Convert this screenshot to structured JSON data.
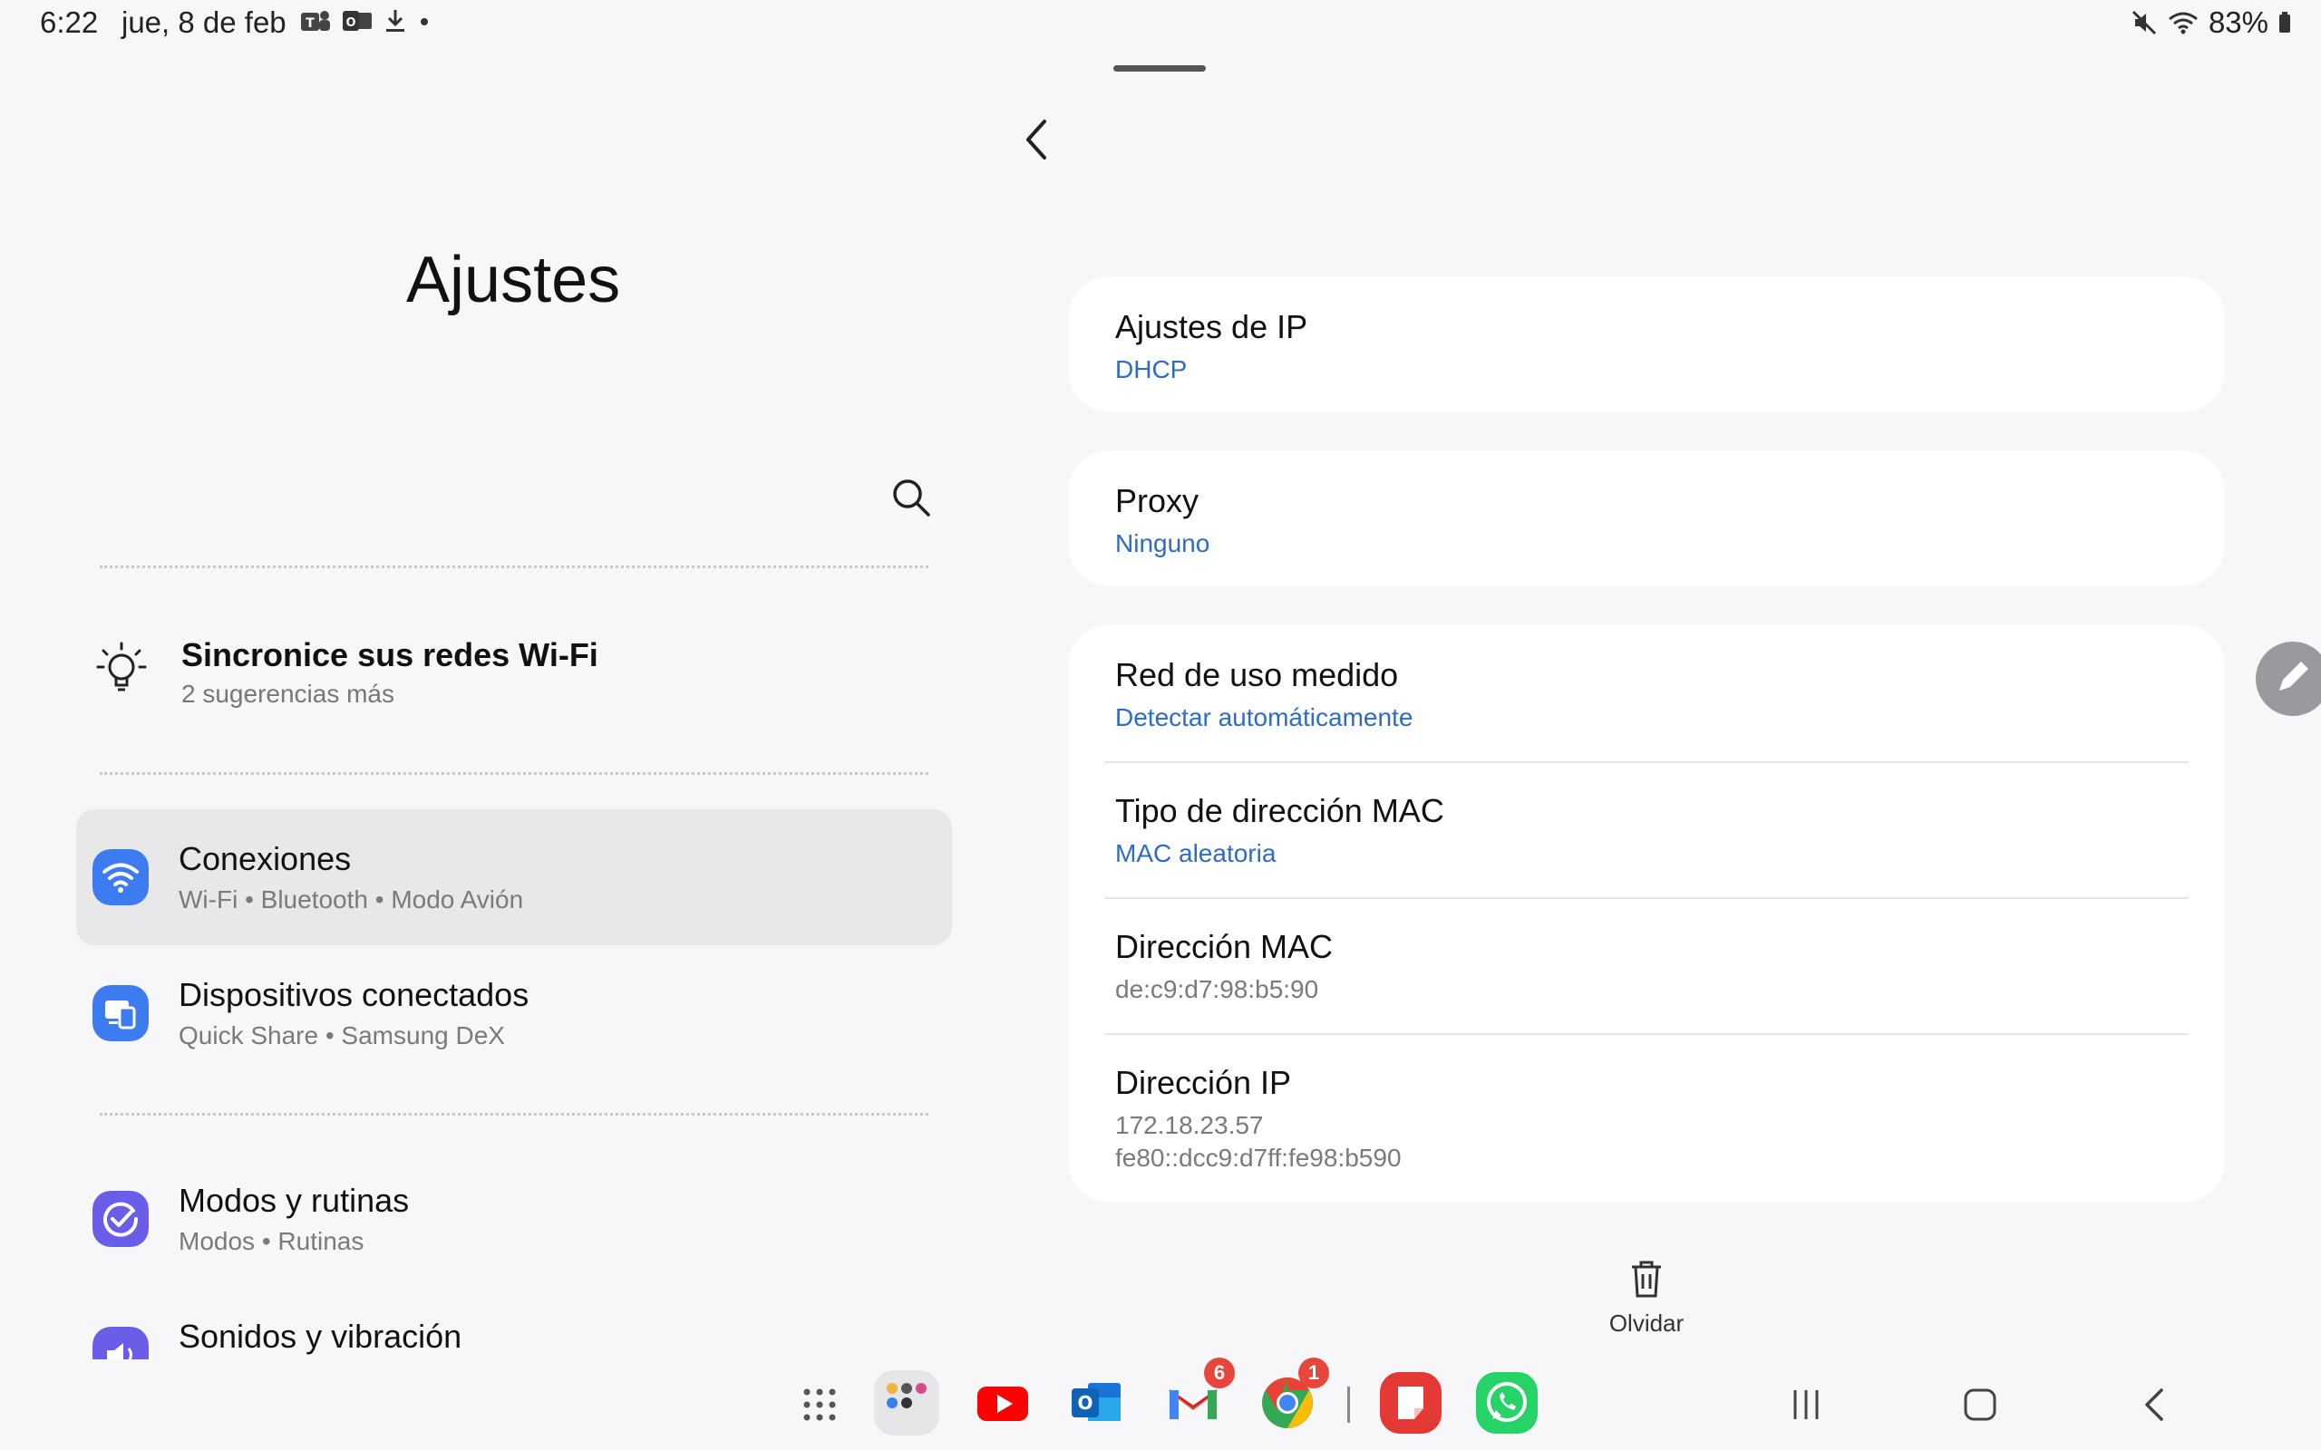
{
  "status_bar": {
    "time": "6:22",
    "date": "jue, 8 de feb",
    "notification_icons": [
      "teams-icon",
      "outlook-icon",
      "download-icon",
      "dot-icon"
    ],
    "battery": "83%"
  },
  "header": {
    "back_icon": "chevron-left-icon"
  },
  "left_panel": {
    "title": "Ajustes",
    "suggestion": {
      "title": "Sincronice sus redes Wi-Fi",
      "subtitle": "2 sugerencias más"
    },
    "menu": [
      {
        "title": "Conexiones",
        "subtitle": "Wi-Fi  •  Bluetooth  •  Modo Avión",
        "icon": "wifi-icon",
        "color": "#3d7bf0",
        "selected": true
      },
      {
        "title": "Dispositivos conectados",
        "subtitle": "Quick Share  •  Samsung DeX",
        "icon": "devices-icon",
        "color": "#3d7bf0"
      },
      {
        "title": "Modos y rutinas",
        "subtitle": "Modos  •  Rutinas",
        "icon": "check-circle-icon",
        "color": "#6a5de8"
      },
      {
        "title": "Sonidos y vibración",
        "subtitle": "",
        "icon": "sound-icon",
        "color": "#6a5de8"
      }
    ]
  },
  "right_panel": {
    "ip_settings": {
      "title": "Ajustes de IP",
      "value": "DHCP"
    },
    "proxy": {
      "title": "Proxy",
      "value": "Ninguno"
    },
    "metered": {
      "title": "Red de uso medido",
      "value": "Detectar automáticamente"
    },
    "mac_type": {
      "title": "Tipo de dirección MAC",
      "value": "MAC aleatoria"
    },
    "mac_address": {
      "title": "Dirección MAC",
      "value": "de:c9:d7:98:b5:90"
    },
    "ip_address": {
      "title": "Dirección IP",
      "value_v4": "172.18.23.57",
      "value_v6": "fe80::dcc9:d7ff:fe98:b590"
    },
    "forget_label": "Olvidar"
  },
  "dock": {
    "apps": [
      "apps-grid-icon",
      "folder-icon",
      "youtube-icon",
      "outlook-icon",
      "gmail-icon",
      "chrome-icon",
      "notes-icon",
      "whatsapp-icon"
    ],
    "gmail_badge": "6",
    "chrome_badge": "1"
  },
  "colors": {
    "accent_blue": "#2f6bc4",
    "background": "#f7f7f9",
    "card": "#ffffff"
  }
}
